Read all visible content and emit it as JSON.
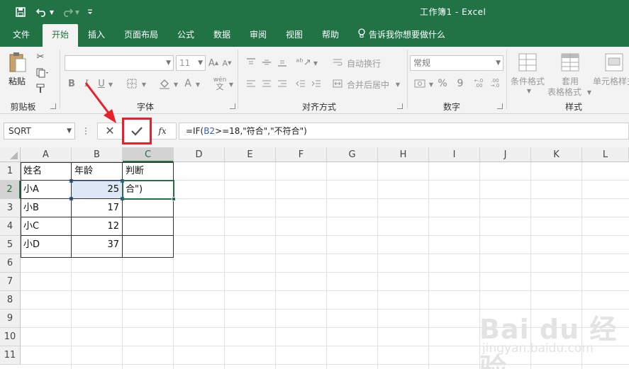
{
  "titlebar": {
    "title": "工作簿1  -   Excel",
    "icons": [
      "save-icon",
      "undo-icon",
      "undo-dropdown-icon",
      "redo-icon",
      "customize-quick-access-icon"
    ]
  },
  "tabs": [
    "文件",
    "开始",
    "插入",
    "页面布局",
    "公式",
    "数据",
    "审阅",
    "视图",
    "帮助"
  ],
  "active_tab": "开始",
  "tell_me": "告诉我你想要做什么",
  "ribbon": {
    "clipboard": {
      "paste": "粘贴",
      "label": "剪贴板"
    },
    "font": {
      "label": "字体",
      "size": "11",
      "bold": "B",
      "italic": "I",
      "underline": "U",
      "phonetic": "wén"
    },
    "alignment": {
      "label": "对齐方式",
      "wrap": "自动换行",
      "merge": "合并后居中"
    },
    "number": {
      "label": "数字",
      "format": "常规",
      "percent": "%",
      "comma": "9"
    },
    "styles": {
      "label": "样式",
      "conditional": "条件格式",
      "table_line1": "套用",
      "table_line2": "表格格式",
      "cell_styles": "单元格样式"
    }
  },
  "formula_bar": {
    "name_box": "SQRT",
    "fx": "fx",
    "formula_prefix": "=IF(",
    "formula_ref": "B2",
    "formula_rest": ">=18,\"符合\",\"不符合\")"
  },
  "columns": [
    "A",
    "B",
    "C",
    "D",
    "E",
    "F",
    "G",
    "H",
    "I",
    "J",
    "K",
    "L"
  ],
  "rows": [
    "1",
    "2",
    "3",
    "4",
    "5",
    "6",
    "7",
    "8",
    "9",
    "10",
    "11"
  ],
  "cells": {
    "A1": "姓名",
    "B1": "年龄",
    "C1": "判断",
    "A2": "小A",
    "B2": "25",
    "C2": "合\")",
    "A3": "小B",
    "B3": "17",
    "A4": "小C",
    "B4": "12",
    "A5": "小D",
    "B5": "37"
  },
  "watermark": {
    "brand": "Bai du 经验",
    "url": "jingyan.baidu.com"
  }
}
